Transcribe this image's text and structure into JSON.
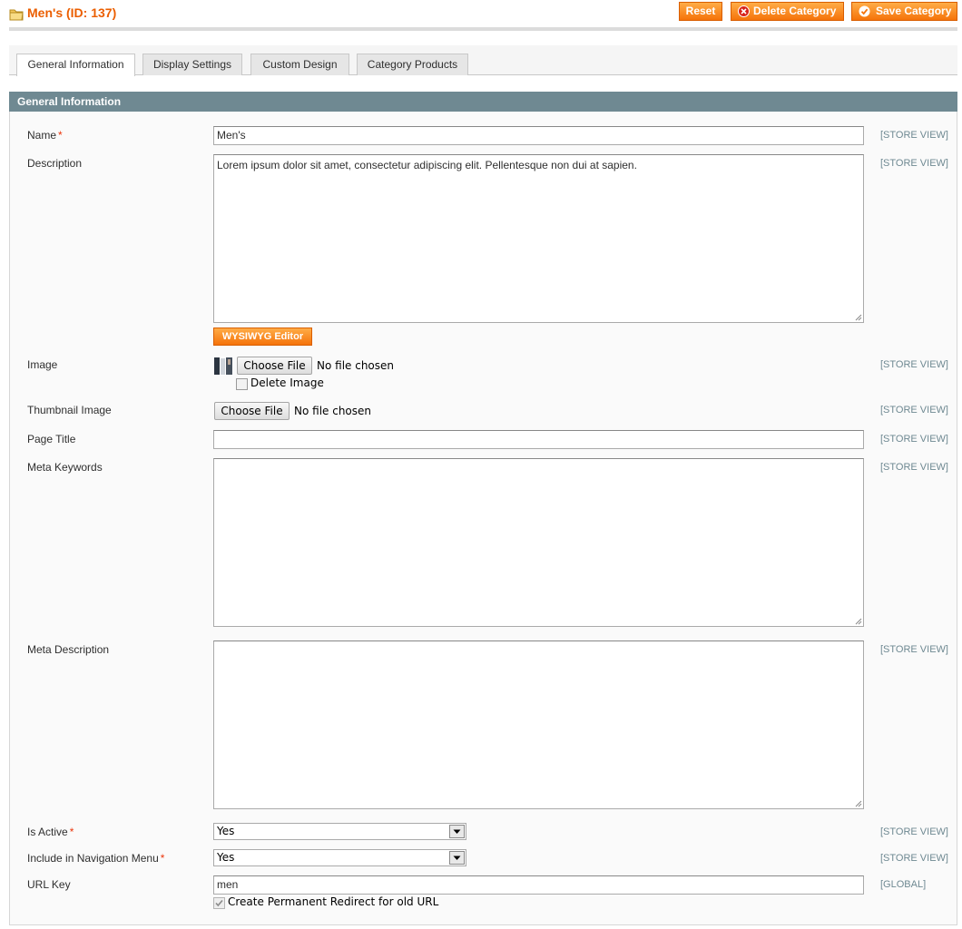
{
  "header": {
    "title": "Men's (ID: 137)",
    "buttons": {
      "reset": "Reset",
      "delete": "Delete Category",
      "save": "Save Category"
    }
  },
  "tabs": [
    {
      "label": "General Information",
      "active": true
    },
    {
      "label": "Display Settings",
      "active": false
    },
    {
      "label": "Custom Design",
      "active": false
    },
    {
      "label": "Category Products",
      "active": false
    }
  ],
  "section": {
    "title": "General Information"
  },
  "fields": {
    "name": {
      "label": "Name",
      "required_mark": "*",
      "value": "Men's",
      "scope": "[STORE VIEW]"
    },
    "description": {
      "label": "Description",
      "value": "Lorem ipsum dolor sit amet, consectetur adipiscing elit. Pellentesque non dui at sapien.",
      "scope": "[STORE VIEW]",
      "editor_button": "WYSIWYG Editor"
    },
    "image": {
      "label": "Image",
      "choose_file": "Choose File",
      "file_status": "No file chosen",
      "delete_label": "Delete Image",
      "scope": "[STORE VIEW]"
    },
    "thumbnail": {
      "label": "Thumbnail Image",
      "choose_file": "Choose File",
      "file_status": "No file chosen",
      "scope": "[STORE VIEW]"
    },
    "page_title": {
      "label": "Page Title",
      "value": "",
      "scope": "[STORE VIEW]"
    },
    "meta_keywords": {
      "label": "Meta Keywords",
      "value": "",
      "scope": "[STORE VIEW]"
    },
    "meta_description": {
      "label": "Meta Description",
      "value": "",
      "scope": "[STORE VIEW]"
    },
    "is_active": {
      "label": "Is Active",
      "required_mark": "*",
      "value": "Yes",
      "scope": "[STORE VIEW]"
    },
    "include_in_menu": {
      "label": "Include in Navigation Menu",
      "required_mark": "*",
      "value": "Yes",
      "scope": "[STORE VIEW]"
    },
    "url_key": {
      "label": "URL Key",
      "value": "men",
      "scope": "[GLOBAL]",
      "redirect_label": "Create Permanent Redirect for old URL",
      "redirect_checked": true
    }
  },
  "colors": {
    "accent": "#eb5e00",
    "button": "#f5730a",
    "section_header": "#6f8992",
    "required": "#eb340a"
  }
}
